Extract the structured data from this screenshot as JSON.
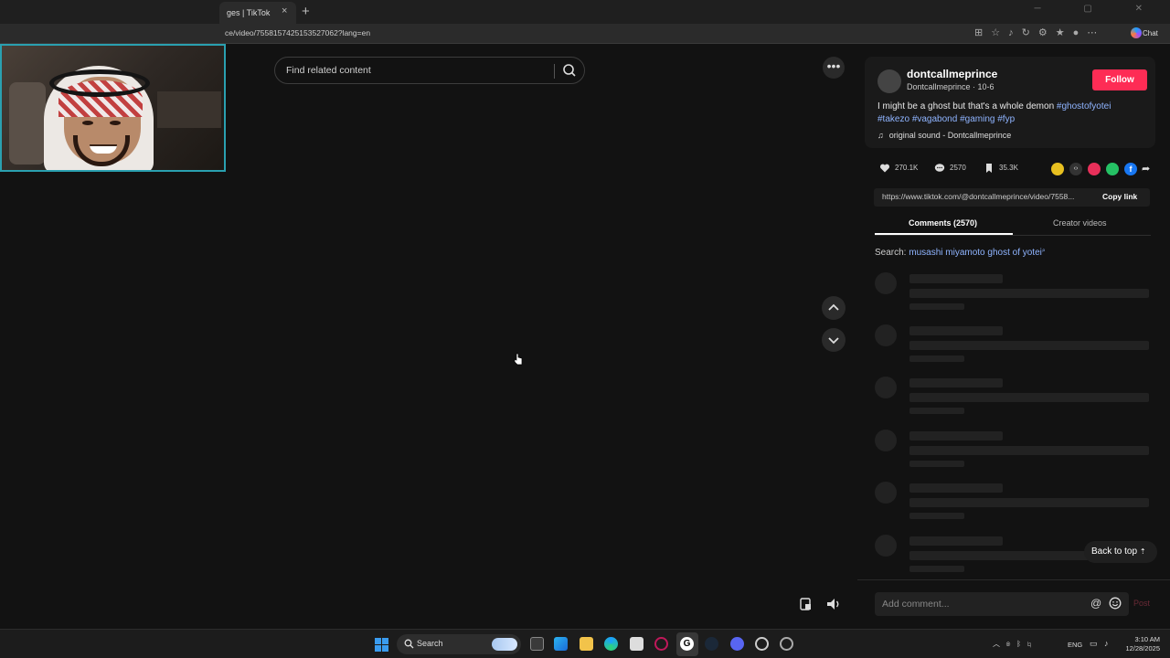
{
  "browser": {
    "tab_title": "ges | TikTok",
    "tab_close": "×",
    "new_tab": "+",
    "url": "ce/video/7558157425153527062?lang=en",
    "chat_label": "Chat",
    "window_controls": "─ ▢ ✕"
  },
  "video": {
    "search_placeholder": "Find related content",
    "more_label": "•••"
  },
  "post": {
    "username": "dontcallmeprince",
    "nickname_date": "Dontcallmeprince · 10-6",
    "follow_label": "Follow",
    "caption_text": "I might be a ghost but that's a whole demon ",
    "hashtags": [
      "#ghostofyotei",
      "#takezo",
      "#vagabond",
      "#gaming",
      "#fyp"
    ],
    "music": "original sound - Dontcallmeprince",
    "likes": "270.1K",
    "comments": "2570",
    "saves": "35.3K",
    "link": "https://www.tiktok.com/@dontcallmeprince/video/7558...",
    "copy_link_label": "Copy link"
  },
  "tabs": {
    "comments": "Comments (2570)",
    "creator_videos": "Creator videos"
  },
  "search_suggest": {
    "prefix": "Search: ",
    "query": "musashi miyamoto ghost of yotei"
  },
  "back_to_top": "Back to top",
  "comment_input": {
    "placeholder": "Add comment...",
    "at": "@",
    "post_label": "Post"
  },
  "taskbar": {
    "search_label": "Search",
    "lang": "ENG",
    "time": "3:10 AM",
    "date": "12/28/2025"
  },
  "colors": {
    "accent": "#fe2c55",
    "hashtag": "#8fb4ff",
    "background": "#121212"
  }
}
